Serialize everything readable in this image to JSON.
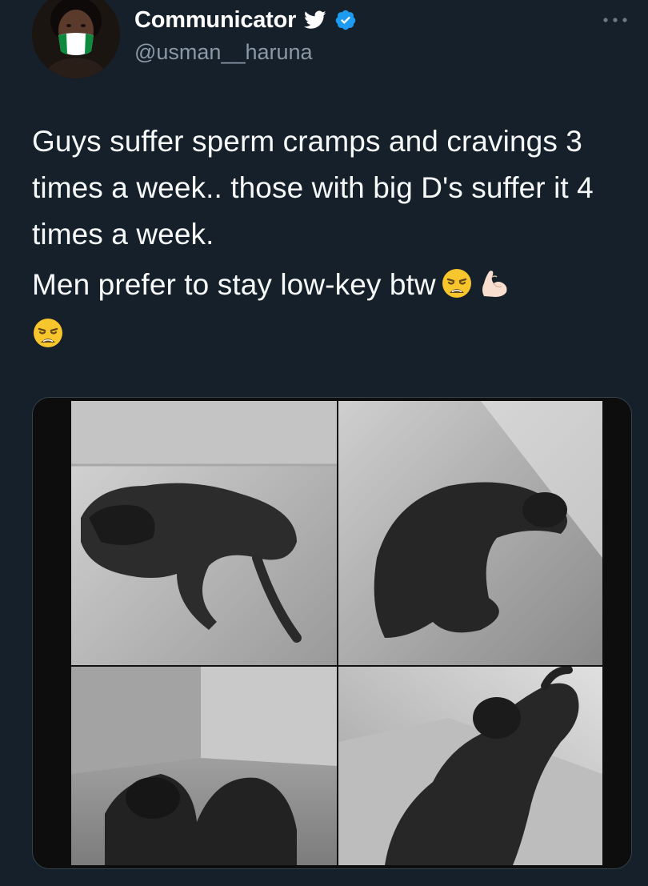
{
  "user": {
    "display_name": "Communicator",
    "handle": "@usman__haruna",
    "avatar_icon": "profile-avatar",
    "badges": [
      "twitter-bird-icon",
      "verified-badge-icon"
    ]
  },
  "tweet": {
    "paragraph_1": "Guys suffer sperm cramps and cravings 3 times a week.. those with big D's suffer it 4 times a week.",
    "paragraph_2": "Men prefer to stay low-key btw",
    "emojis": [
      "😩",
      "💪",
      "😩"
    ]
  },
  "menu": {
    "more_icon": "more-options-icon"
  },
  "colors": {
    "background": "#15202b",
    "text": "#f7f9f9",
    "secondary_text": "#8b98a5",
    "verified_blue": "#1d9bf0"
  },
  "media": {
    "description_icon": "photo-grid-image"
  }
}
